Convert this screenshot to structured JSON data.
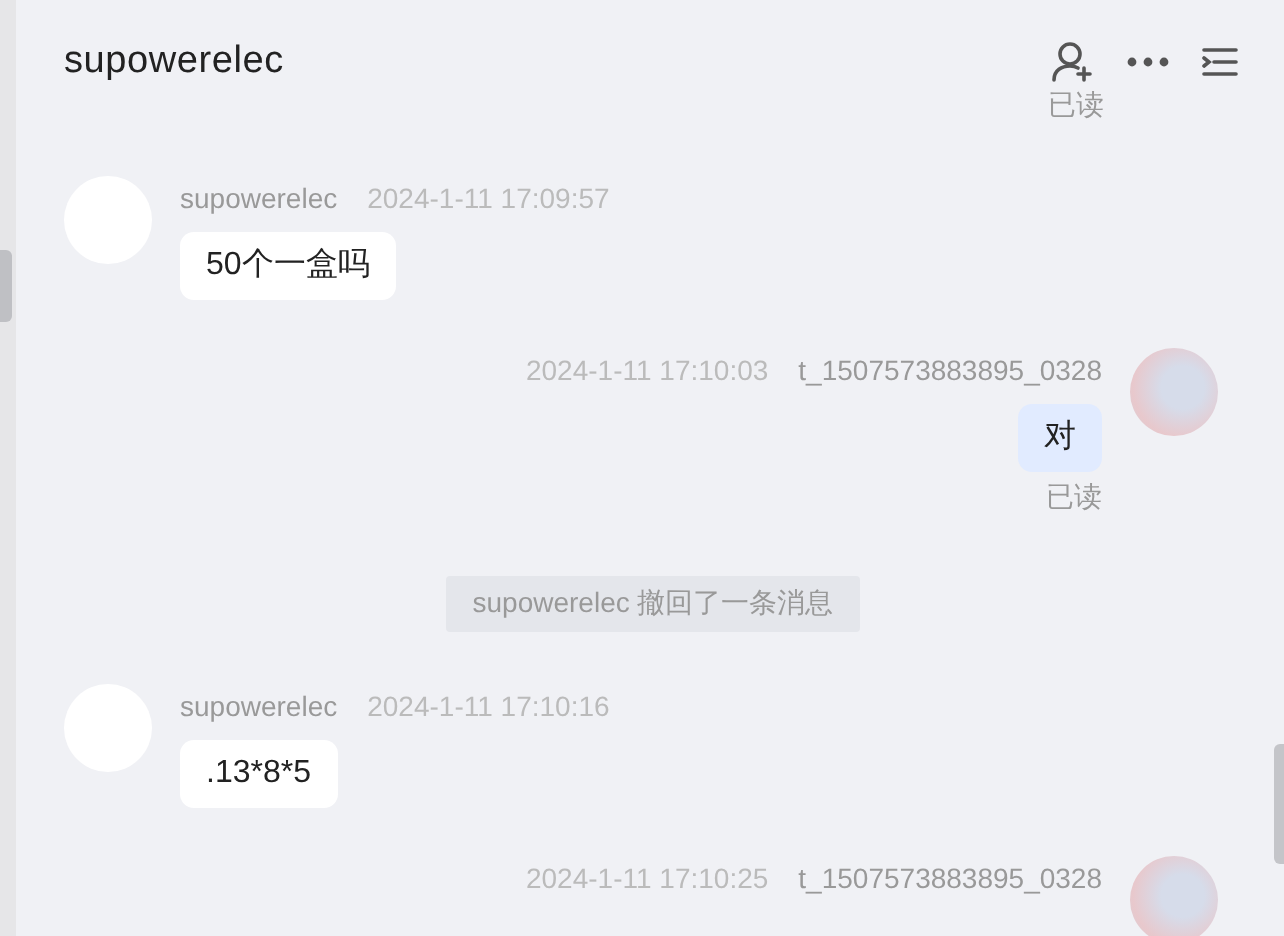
{
  "header": {
    "title": "supowerelec"
  },
  "messages": [
    {
      "kind": "receipt",
      "read_label": "已读"
    },
    {
      "kind": "incoming",
      "sender": "supowerelec",
      "time": "2024-1-11 17:09:57",
      "text": "50个一盒吗"
    },
    {
      "kind": "outgoing",
      "sender": "t_1507573883895_0328",
      "time": "2024-1-11 17:10:03",
      "text": "对",
      "read_label": "已读"
    },
    {
      "kind": "system",
      "text": "supowerelec 撤回了一条消息"
    },
    {
      "kind": "incoming",
      "sender": "supowerelec",
      "time": "2024-1-11 17:10:16",
      "text": ".13*8*5"
    },
    {
      "kind": "outgoing",
      "sender": "t_1507573883895_0328",
      "time": "2024-1-11 17:10:25"
    }
  ]
}
